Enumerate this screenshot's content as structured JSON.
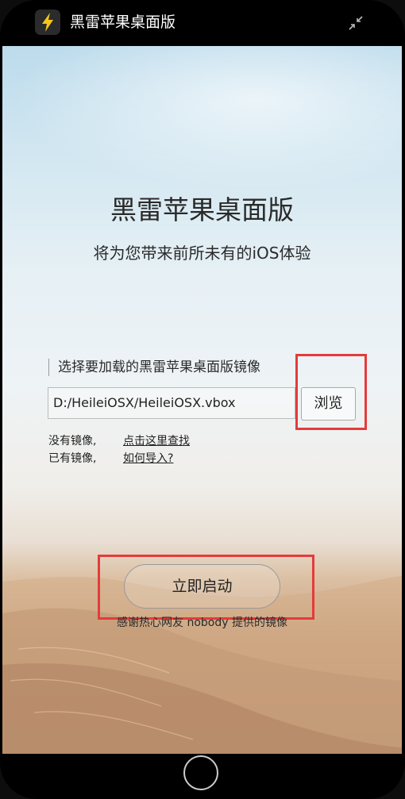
{
  "titlebar": {
    "app_name": "黑雷苹果桌面版",
    "icon": "lightning-bolt-icon",
    "collapse_icon": "collapse-arrows-icon"
  },
  "main": {
    "headline": "黑雷苹果桌面版",
    "subtitle": "将为您带来前所未有的iOS体验",
    "select_label": "选择要加载的黑雷苹果桌面版镜像",
    "path_value": "D:/HeileiOSX/HeileiOSX.vbox",
    "browse_label": "浏览",
    "no_image_text": "没有镜像,",
    "find_here_link": "点击这里查找",
    "has_image_text": "已有镜像,",
    "how_import_link": "如何导入?",
    "start_label": "立即启动",
    "credits": "感谢热心网友 nobody 提供的镜像"
  },
  "colors": {
    "accent_highlight": "#e43b3b",
    "icon_bolt": "#f5c518",
    "frame": "#000000"
  }
}
